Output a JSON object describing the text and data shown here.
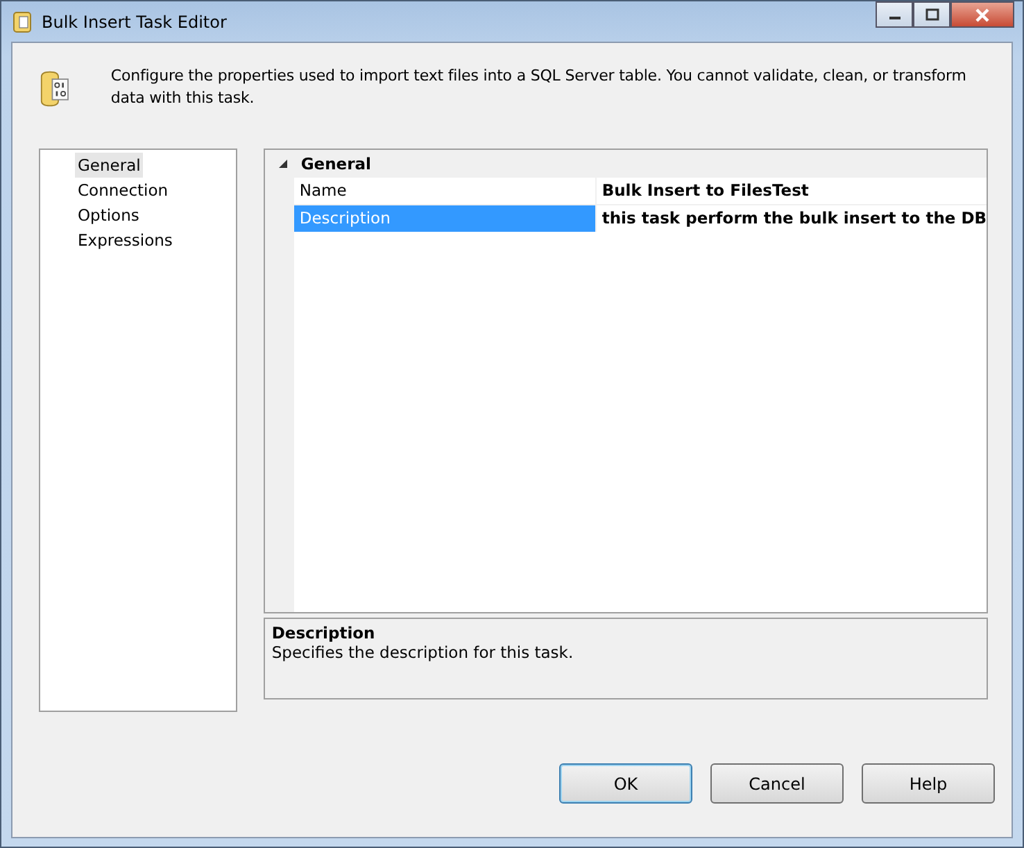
{
  "window": {
    "title": "Bulk Insert Task Editor"
  },
  "header": {
    "text": "Configure the properties used to import text files into a SQL Server table. You cannot validate, clean, or transform data with this task."
  },
  "nav": {
    "items": [
      {
        "label": "General",
        "selected": true
      },
      {
        "label": "Connection",
        "selected": false
      },
      {
        "label": "Options",
        "selected": false
      },
      {
        "label": "Expressions",
        "selected": false
      }
    ]
  },
  "property_grid": {
    "category": "General",
    "expanded": true,
    "rows": [
      {
        "name": "Name",
        "value": "Bulk Insert to FilesTest",
        "selected": false
      },
      {
        "name": "Description",
        "value": "this task perform the bulk insert to the DB",
        "selected": true
      }
    ]
  },
  "description_panel": {
    "title": "Description",
    "text": "Specifies the description for this task."
  },
  "buttons": [
    {
      "label": "OK",
      "default": true
    },
    {
      "label": "Cancel",
      "default": false
    },
    {
      "label": "Help",
      "default": false
    }
  ]
}
